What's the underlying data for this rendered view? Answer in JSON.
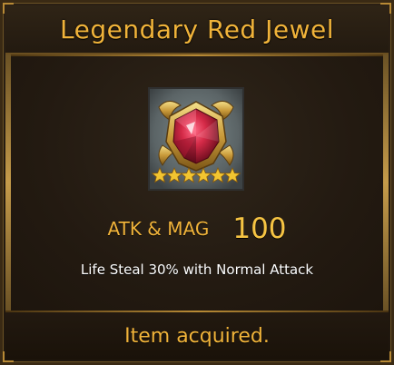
{
  "dialog": {
    "title": "Legendary Red Jewel",
    "item_icon": "red-jewel-icon",
    "star_rating": {
      "stars": 6,
      "icon": "star-icon",
      "color": "#f2c531"
    },
    "stat": {
      "label": "ATK & MAG",
      "value": "100"
    },
    "description": "Life Steal 30% with Normal Attack",
    "footer": "Item acquired."
  },
  "colors": {
    "accent_gold": "#f0b33a",
    "jewel_red": "#c8243e",
    "icon_background": "#5f6668"
  }
}
